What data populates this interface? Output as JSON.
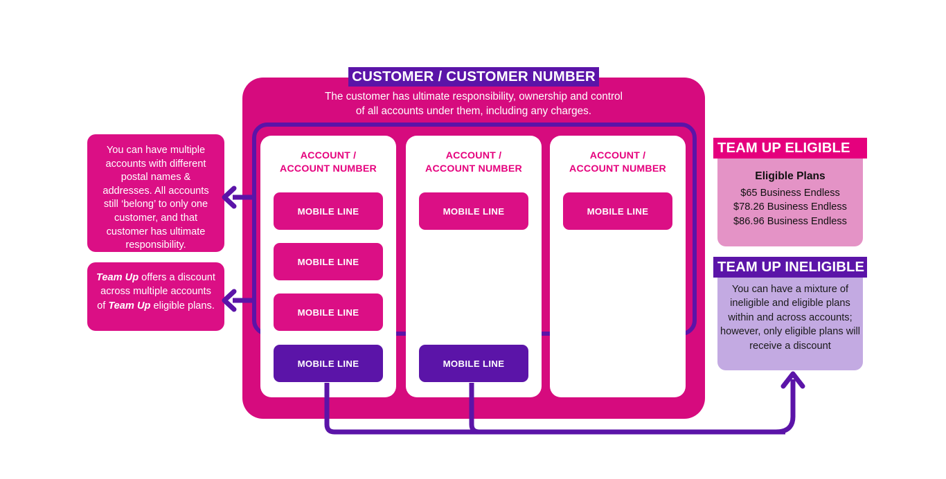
{
  "customer": {
    "title": "CUSTOMER / CUSTOMER NUMBER",
    "subtitle_line1": "The customer has ultimate responsibility, ownership and control",
    "subtitle_line2": "of all accounts under them, including any charges."
  },
  "accounts": [
    {
      "title_line1": "ACCOUNT /",
      "title_line2": "ACCOUNT NUMBER",
      "lines": [
        {
          "label": "MOBILE LINE",
          "type": "eligible"
        },
        {
          "label": "MOBILE LINE",
          "type": "eligible"
        },
        {
          "label": "MOBILE LINE",
          "type": "eligible"
        },
        {
          "label": "MOBILE LINE",
          "type": "ineligible"
        }
      ]
    },
    {
      "title_line1": "ACCOUNT /",
      "title_line2": "ACCOUNT NUMBER",
      "lines": [
        {
          "label": "MOBILE LINE",
          "type": "eligible"
        },
        {
          "label": "MOBILE LINE",
          "type": "ineligible"
        }
      ]
    },
    {
      "title_line1": "ACCOUNT /",
      "title_line2": "ACCOUNT NUMBER",
      "lines": [
        {
          "label": "MOBILE LINE",
          "type": "eligible"
        }
      ]
    }
  ],
  "callouts": {
    "accounts_note": "You can have multiple accounts with different postal names & addresses. All accounts still ‘belong’ to only one customer, and that customer has ultimate responsibility.",
    "teamup_note_pre": "",
    "teamup_brand_1": "Team Up",
    "teamup_note_mid": " offers a discount across multiple accounts of ",
    "teamup_brand_2": "Team Up",
    "teamup_note_post": " eligible plans."
  },
  "panels": {
    "eligible": {
      "header": "TEAM UP ELIGIBLE",
      "plans_title": "Eligible Plans",
      "plans": [
        "$65 Business Endless",
        "$78.26 Business Endless",
        "$86.96 Business Endless"
      ]
    },
    "ineligible": {
      "header": "TEAM UP INELIGIBLE",
      "body": "You can have a mixture of ineligible and eligible plans within and across accounts; however, only eligible plans will receive a discount"
    }
  },
  "colors": {
    "pink": "#D60B7E",
    "pink_bright": "#E5007D",
    "purple": "#5B14A8",
    "eligible_panel": "#E493C6",
    "ineligible_panel": "#C3AAE2"
  }
}
